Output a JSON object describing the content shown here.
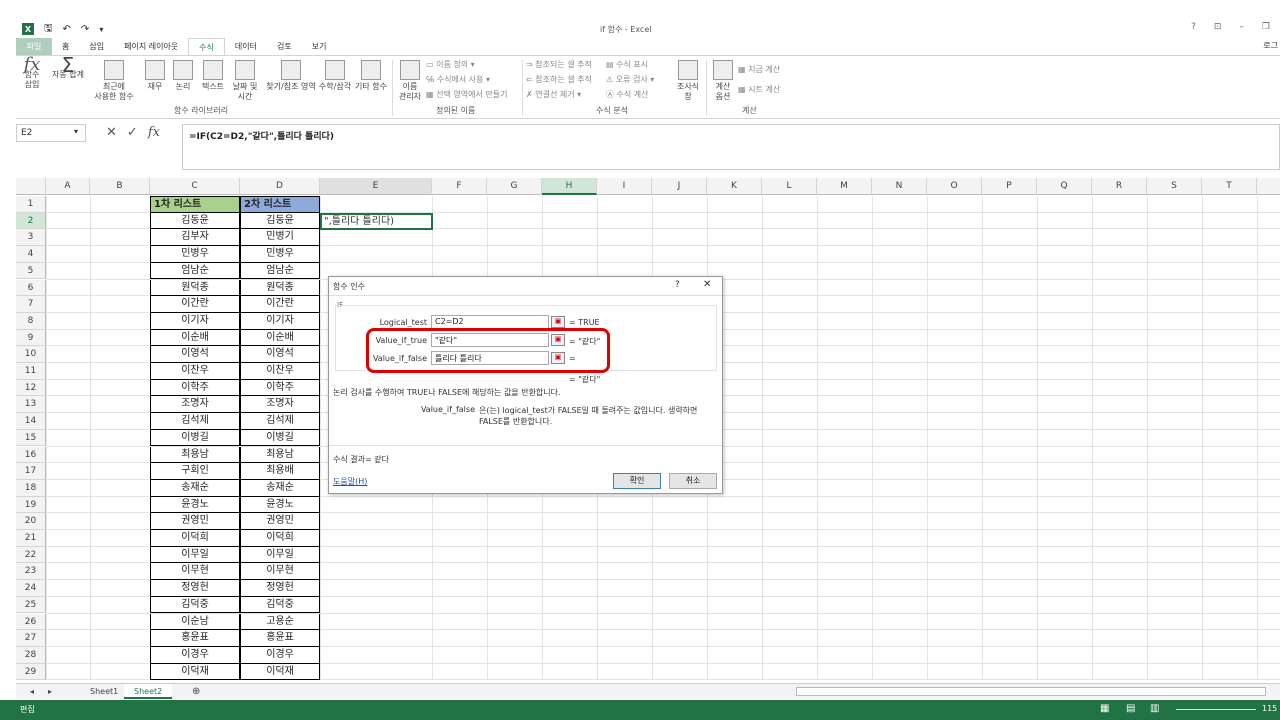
{
  "window": {
    "title": "if 함수 - Excel",
    "user": "로그"
  },
  "tabs": [
    "파일",
    "홈",
    "삽입",
    "페이지 레이아웃",
    "수식",
    "데이터",
    "검토",
    "보기"
  ],
  "active_tab": "수식",
  "ribbon": {
    "insert_function": "함수\n삽입",
    "autosum": "자동 합계",
    "recent": "최근에\n사용한 함수",
    "financial": "재무",
    "logical": "논리",
    "text": "텍스트",
    "datetime": "날짜 및\n시간",
    "lookup": "찾기/참조 영역",
    "math": "수학/삼각",
    "more": "기타 함수",
    "group_library": "함수 라이브러리",
    "name_manager": "이름\n관리자",
    "define_name": "이름 정의",
    "use_in_formula": "수식에서 사용",
    "create_from_selection": "선택 영역에서 만들기",
    "group_names": "정의된 이름",
    "trace_precedents": "참조되는 셀 추적",
    "trace_dependents": "참조하는 셀 추적",
    "remove_arrows": "연결선 제거",
    "show_formulas": "수식 표시",
    "error_checking": "오류 검사",
    "evaluate_formula": "수식 계산",
    "watch_window": "조사식\n창",
    "group_audit": "수식 분석",
    "calc_options": "계산\n옵션",
    "calc_now": "지금 계산",
    "calc_sheet": "시트 계산",
    "group_calc": "계산"
  },
  "formula_bar": {
    "name_box": "E2",
    "formula": "=IF(C2=D2,\"같다\",틀리다 틀리다)"
  },
  "columns": [
    "A",
    "B",
    "C",
    "D",
    "E",
    "F",
    "G",
    "H",
    "I",
    "J",
    "K",
    "L",
    "M",
    "N",
    "O",
    "P",
    "Q",
    "R",
    "S",
    "T"
  ],
  "rows": [
    "1",
    "2",
    "3",
    "4",
    "5",
    "6",
    "7",
    "8",
    "9",
    "10",
    "11",
    "12",
    "13",
    "14",
    "15",
    "16",
    "17",
    "18",
    "19",
    "20",
    "21",
    "22",
    "23",
    "24",
    "25",
    "26",
    "27",
    "28",
    "29"
  ],
  "header_c": "1차 리스트",
  "header_d": "2차 리스트",
  "list1": [
    "김동윤",
    "김부자",
    "민병우",
    "엄남순",
    "원덕종",
    "이간란",
    "이기자",
    "이순배",
    "이영석",
    "이찬우",
    "이학주",
    "조명자",
    "김석제",
    "이병길",
    "최용남",
    "구회인",
    "송재순",
    "윤경노",
    "권영민",
    "이덕희",
    "이무일",
    "이무현",
    "정영헌",
    "김덕중",
    "이순남",
    "홍윤표",
    "이경우",
    "이덕재"
  ],
  "list2": [
    "김동윤",
    "민병기",
    "민병우",
    "엄남순",
    "원덕종",
    "이간란",
    "이기자",
    "이순배",
    "이영석",
    "이찬우",
    "이학주",
    "조명자",
    "김석제",
    "이병길",
    "최용남",
    "최용배",
    "송재순",
    "윤경노",
    "권영민",
    "이덕희",
    "이무일",
    "이무현",
    "정영헌",
    "김덕중",
    "고용순",
    "홍윤표",
    "이경우",
    "이덕재"
  ],
  "e2_value": "\",틀리다 틀리다)",
  "dialog": {
    "title": "함수 인수",
    "help_q": "?",
    "close": "✕",
    "func": "IF",
    "labels": [
      "Logical_test",
      "Value_if_true",
      "Value_if_false"
    ],
    "values": [
      "C2=D2",
      "\"같다\"",
      "틀리다 틀리다"
    ],
    "results": [
      "=  TRUE",
      "=  \"같다\"",
      "="
    ],
    "overall_result": "=  \"같다\"",
    "description": "논리 검사를 수행하여 TRUE나 FALSE에 해당하는 값을 반환합니다.",
    "arg_name": "Value_if_false",
    "arg_desc": "은(는) logical_test가 FALSE일 때 돌려주는 값입니다. 생략하면\nFALSE를 반환합니다.",
    "formula_result": "수식 결과=  같다",
    "help_link": "도움말(H)",
    "ok": "확인",
    "cancel": "취소"
  },
  "sheets": [
    "Sheet1",
    "Sheet2"
  ],
  "active_sheet": "Sheet2",
  "status": {
    "mode": "편집",
    "zoom": "115"
  },
  "colors": {
    "accent": "#217346",
    "highlight_red": "#e00000",
    "header_c_bg": "#a9d18e",
    "header_d_bg": "#8eaadb"
  }
}
